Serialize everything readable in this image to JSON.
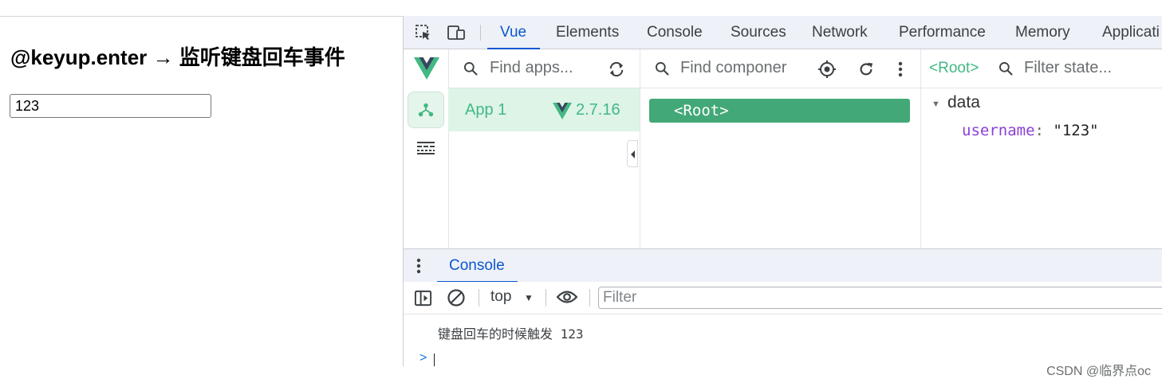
{
  "page": {
    "title": "@keyup.enter → 监听键盘回车事件",
    "input_value": "123"
  },
  "devtools": {
    "tabs": [
      "Vue",
      "Elements",
      "Console",
      "Sources",
      "Network",
      "Performance",
      "Memory",
      "Applicati"
    ],
    "active_tab": "Vue"
  },
  "vue": {
    "apps_search_placeholder": "Find apps...",
    "app_name": "App 1",
    "app_version": "2.7.16",
    "components_search_placeholder": "Find componer",
    "root_component": "<Root>",
    "state_component": "<Root>",
    "state_filter_placeholder": "Filter state...",
    "data_section": "data",
    "state_key": "username",
    "state_value": "\"123\"",
    "brand_color": "#42b883"
  },
  "drawer": {
    "tab": "Console",
    "context": "top",
    "filter_placeholder": "Filter",
    "log_message": "键盘回车的时候触发 123"
  },
  "watermark": "CSDN @临界点oc",
  "icons": [
    "inspect-icon",
    "device-toggle-icon",
    "vue-logo-icon",
    "component-tree-icon",
    "timeline-icon",
    "settings-gear-icon",
    "search-icon",
    "refresh-apps-icon",
    "select-component-icon",
    "refresh-icon",
    "more-vert-icon",
    "sidebar-toggle-icon",
    "clear-console-icon",
    "eye-icon"
  ]
}
